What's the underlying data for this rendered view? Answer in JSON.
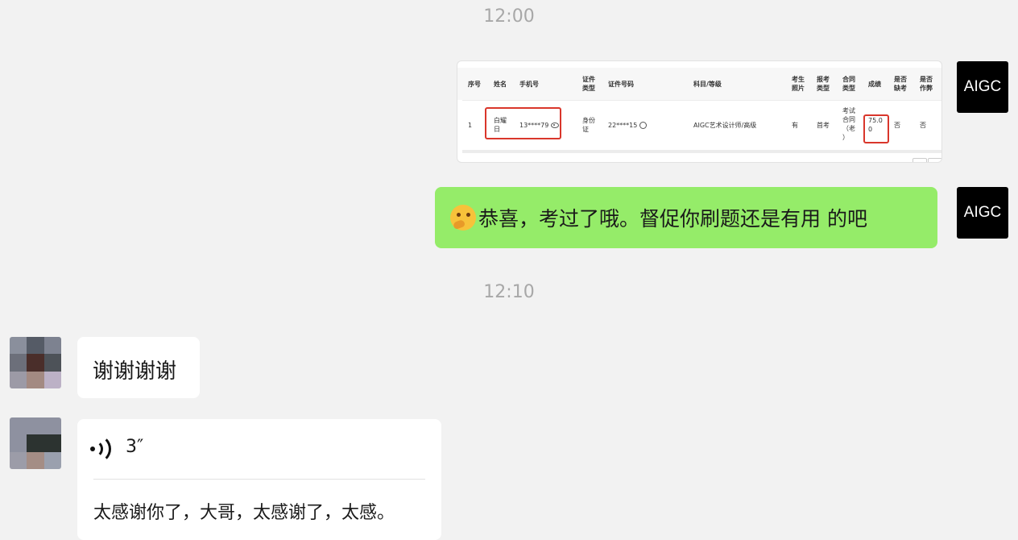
{
  "chat": {
    "time1": "12:00",
    "time2": "12:10",
    "my_avatar": "AIGC",
    "green_message": "恭喜，考过了哦。督促你刷题还是有用 的吧",
    "green_emoji": "thinking-face-icon",
    "thanks_message": "谢谢谢谢",
    "voice_duration": "3″",
    "voice_transcript": "太感谢你了，大哥，太感谢了，太感。"
  },
  "screenshot": {
    "headers": [
      "序号",
      "姓名",
      "手机号",
      "证件\n类型",
      "证件号码",
      "科目/等级",
      "考生\n照片",
      "报考\n类型",
      "合同\n类型",
      "成绩",
      "是否\n缺考",
      "是否\n作弊"
    ],
    "row": {
      "index": "1",
      "name": "白耀\n日",
      "phone": "13****79",
      "id_type": "身份\n证",
      "id_number": "22****15",
      "subject": "AIGC艺术设计师/高级",
      "photo": "有",
      "apply_type": "首考",
      "contract": "考试\n合同\n（老\n）",
      "score": "75.0\n0",
      "absent": "否",
      "cheat": "否"
    }
  },
  "colors": {
    "background": "#f2f2f2",
    "green_bubble": "#95ec69",
    "highlight_box": "#d9362b"
  }
}
